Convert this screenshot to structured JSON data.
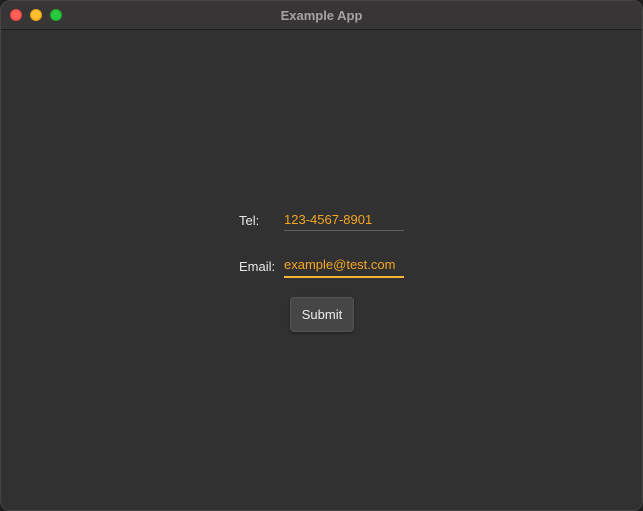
{
  "window": {
    "title": "Example App",
    "controls": [
      "close-button",
      "minimize-button",
      "maximize-button"
    ]
  },
  "form": {
    "tel": {
      "label": "Tel:",
      "value": "123-4567-8901"
    },
    "email": {
      "label": "Email:",
      "value": "example@test.com"
    },
    "submit_label": "Submit"
  },
  "colors": {
    "accent": "#f5a623",
    "background": "#313131",
    "titlebar": "#383536"
  }
}
